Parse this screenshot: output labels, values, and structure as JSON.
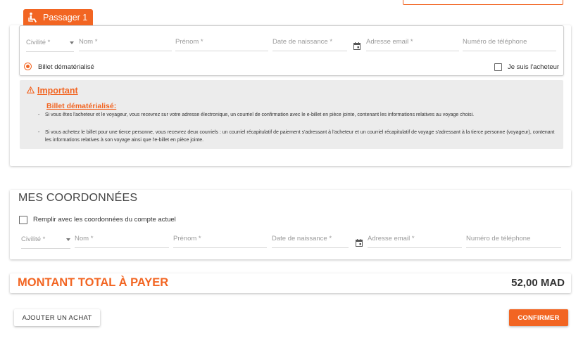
{
  "passenger": {
    "tab_label": "Passager 1",
    "fields": {
      "civilite": "Civilité *",
      "nom": "Nom *",
      "prenom": "Prénom *",
      "date_naissance": "Date de naissance *",
      "email": "Adresse email *",
      "telephone": "Numéro de téléphone"
    },
    "ticket_option": "Billet dématérialisé",
    "buyer_checkbox": "Je suis l'acheteur"
  },
  "important": {
    "title": "Important",
    "subtitle": "Billet dématérialisé:",
    "bullets": [
      "Si vous êtes l'acheteur et le voyageur, vous recevrez sur votre adresse électronique, un courriel de confirmation avec le e-billet en pièce jointe, contenant les informations relatives au voyage choisi.",
      "Si vous achetez le billet pour une tierce personne, vous recevrez deux courriels : un courriel récapitulatif de paiement s'adressant à l'acheteur et un courriel récapitulatif de voyage s'adressant à la tierce personne (voyageur), contenant les informations relatives à son voyage ainsi que l'e-billet en pièce jointe."
    ]
  },
  "coordinates": {
    "title": "MES COORDONNÉES",
    "fill_checkbox": "Remplir avec les coordonnées du compte actuel",
    "fields": {
      "civilite": "Civilité *",
      "nom": "Nom *",
      "prenom": "Prénom *",
      "date_naissance": "Date de naissance *",
      "email": "Adresse email *",
      "telephone": "Numéro de téléphone"
    }
  },
  "total": {
    "label": "MONTANT TOTAL À PAYER",
    "value": "52,00 MAD"
  },
  "buttons": {
    "add_purchase": "AJOUTER UN ACHAT",
    "confirm": "CONFIRMER"
  },
  "colors": {
    "accent": "#f26522",
    "important_bg": "#ececec"
  }
}
